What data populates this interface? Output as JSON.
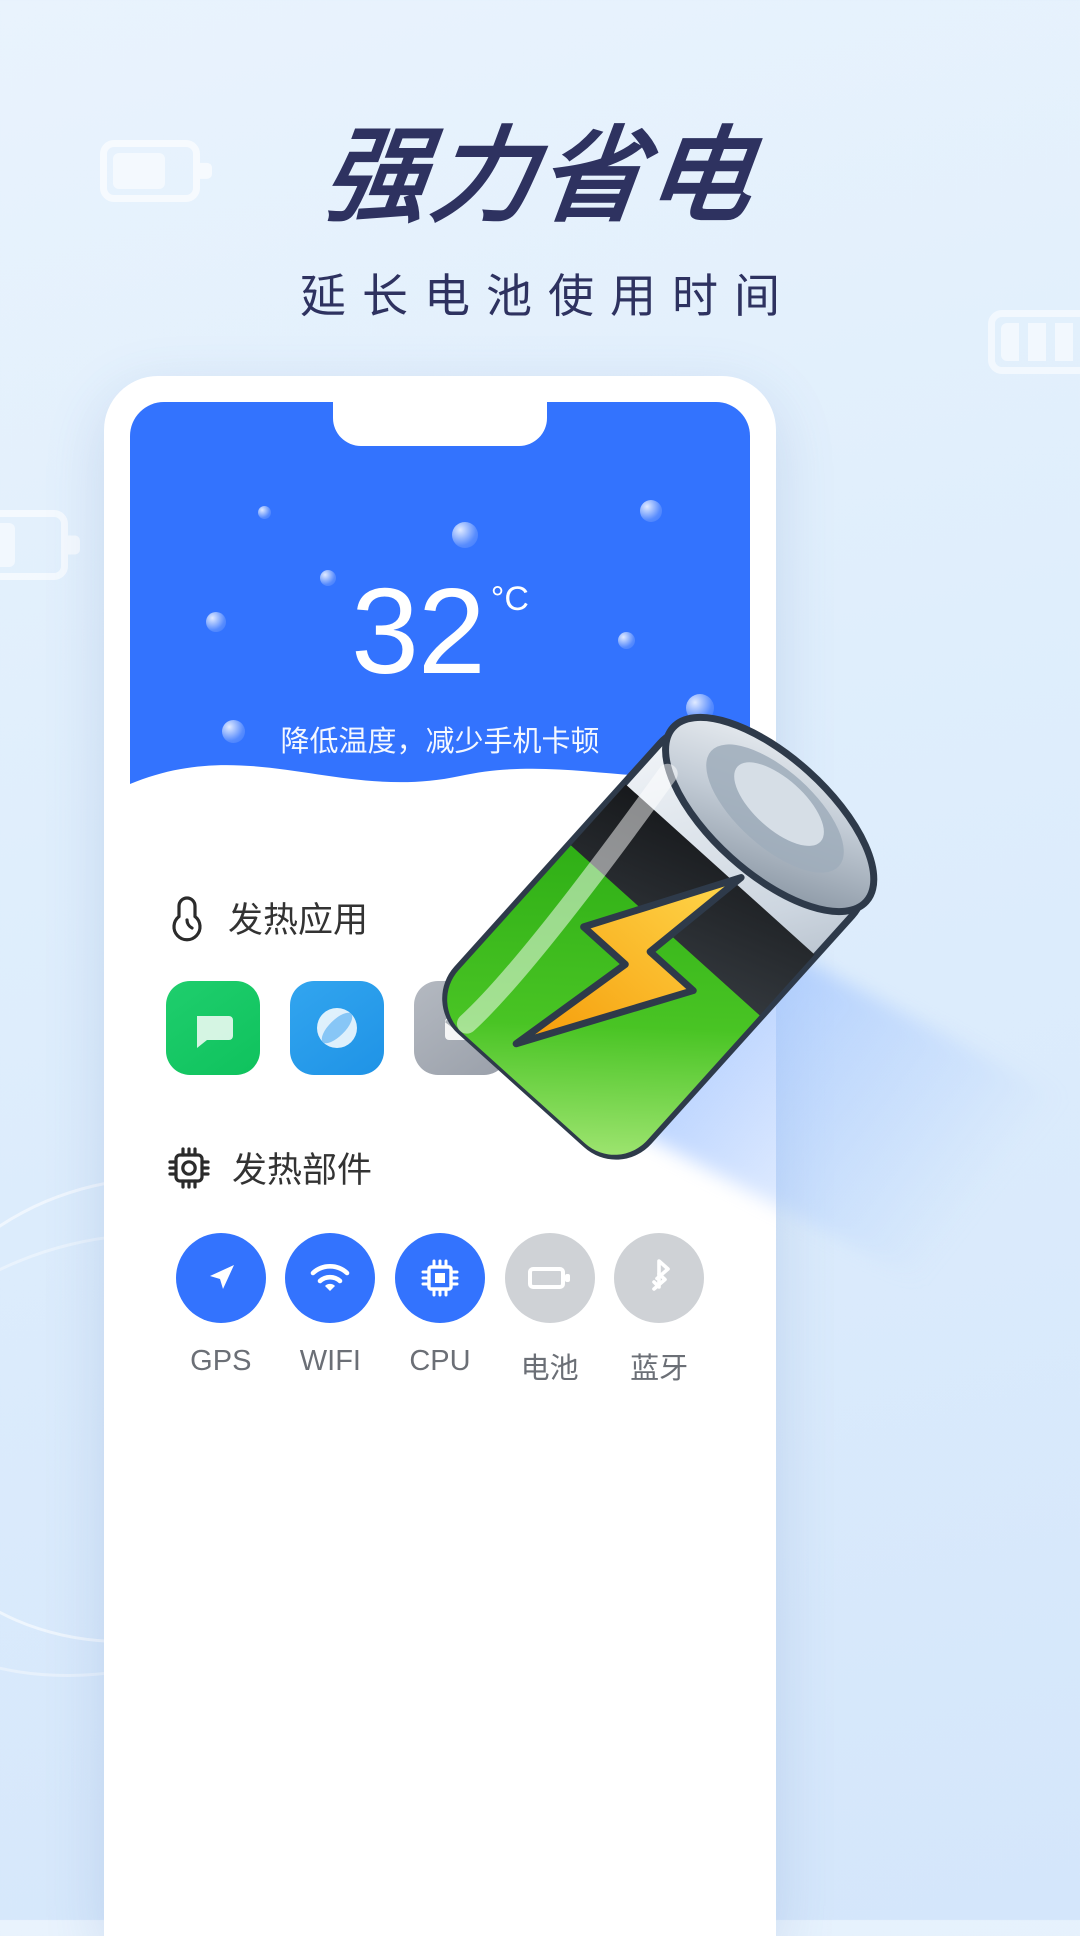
{
  "page": {
    "headline": "强力省电",
    "subline": "延长电池使用时间"
  },
  "colors": {
    "brand_blue": "#3373fe",
    "headline_navy": "#2e3260",
    "page_bg": "#e3eefc",
    "muted_gray": "#cfd2d6",
    "label_gray": "#6b6f76"
  },
  "phone": {
    "temperature": {
      "value": "32",
      "unit": "°C",
      "description": "降低温度，减少手机卡顿"
    },
    "sections": [
      {
        "icon": "thermometer-icon",
        "title": "发热应用",
        "apps": [
          {
            "name": "messages-app-icon",
            "color": "green",
            "glyph": "chat-bubble-icon"
          },
          {
            "name": "browser-app-icon",
            "color": "blue",
            "glyph": "compass-icon"
          },
          {
            "name": "mail-app-icon",
            "color": "gray",
            "glyph": "envelope-icon"
          },
          {
            "name": "video-app-icon",
            "color": "red",
            "glyph": "play-icon"
          }
        ]
      },
      {
        "icon": "cpu-chip-icon",
        "title": "发热部件",
        "parts": [
          {
            "label": "GPS",
            "icon": "location-arrow-icon",
            "active": true
          },
          {
            "label": "WIFI",
            "icon": "wifi-icon",
            "active": true
          },
          {
            "label": "CPU",
            "icon": "cpu-icon",
            "active": true
          },
          {
            "label": "电池",
            "icon": "battery-icon",
            "active": false
          },
          {
            "label": "蓝牙",
            "icon": "bluetooth-icon",
            "active": false
          }
        ]
      }
    ]
  },
  "decor": {
    "battery_art": "charging-battery-illustration",
    "bg_batteries": [
      "battery-outline-small",
      "battery-outline-bars",
      "battery-outline-half"
    ]
  }
}
